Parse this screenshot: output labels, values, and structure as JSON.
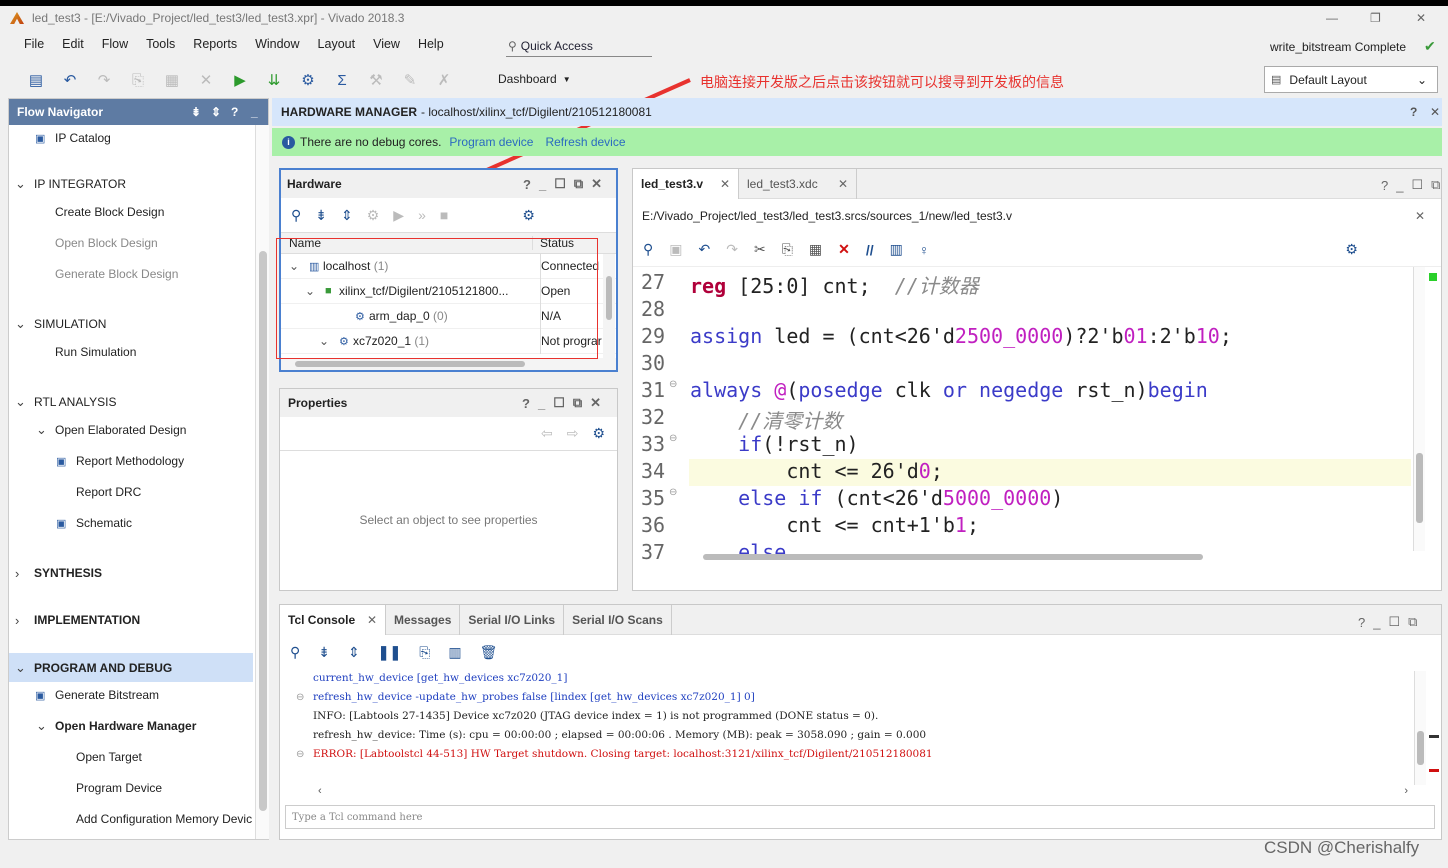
{
  "window": {
    "title": "led_test3 - [E:/Vivado_Project/led_test3/led_test3.xpr] - Vivado 2018.3",
    "min": "—",
    "max": "❐",
    "close": "✕"
  },
  "menu": [
    "File",
    "Edit",
    "Flow",
    "Tools",
    "Reports",
    "Window",
    "Layout",
    "View",
    "Help"
  ],
  "quick_access": "Quick Access",
  "status_right": "write_bitstream Complete",
  "dashboard": "Dashboard",
  "layout_select": "Default Layout",
  "annotation": "电脑连接开发版之后点击该按钮就可以搜寻到开发板的信息",
  "flow_nav": {
    "title": "Flow Navigator",
    "items": [
      {
        "label": "IP Catalog",
        "kind": "sub-icon"
      },
      {
        "label": "IP INTEGRATOR",
        "kind": "section"
      },
      {
        "label": "Create Block Design",
        "kind": "sub"
      },
      {
        "label": "Open Block Design",
        "kind": "sub-disabled"
      },
      {
        "label": "Generate Block Design",
        "kind": "sub-disabled"
      },
      {
        "label": "SIMULATION",
        "kind": "section"
      },
      {
        "label": "Run Simulation",
        "kind": "sub"
      },
      {
        "label": "RTL ANALYSIS",
        "kind": "section"
      },
      {
        "label": "Open Elaborated Design",
        "kind": "sub-open"
      },
      {
        "label": "Report Methodology",
        "kind": "sub2-icon"
      },
      {
        "label": "Report DRC",
        "kind": "sub2"
      },
      {
        "label": "Schematic",
        "kind": "sub2-icon"
      },
      {
        "label": "SYNTHESIS",
        "kind": "section-collapsed"
      },
      {
        "label": "IMPLEMENTATION",
        "kind": "section-collapsed"
      },
      {
        "label": "PROGRAM AND DEBUG",
        "kind": "section-active"
      },
      {
        "label": "Generate Bitstream",
        "kind": "sub-icon"
      },
      {
        "label": "Open Hardware Manager",
        "kind": "sub-open-bold"
      },
      {
        "label": "Open Target",
        "kind": "sub2"
      },
      {
        "label": "Program Device",
        "kind": "sub2"
      },
      {
        "label": "Add Configuration Memory Devic",
        "kind": "sub2"
      }
    ]
  },
  "hw_manager": {
    "title": "HARDWARE MANAGER",
    "path": "- localhost/xilinx_tcf/Digilent/210512180081",
    "banner": "There are no debug cores.",
    "link1": "Program device",
    "link2": "Refresh device"
  },
  "hardware": {
    "title": "Hardware",
    "col_name": "Name",
    "col_status": "Status",
    "rows": [
      {
        "name": "localhost",
        "count": "(1)",
        "status": "Connected"
      },
      {
        "name": "xilinx_tcf/Digilent/2105121800...",
        "count": "",
        "status": "Open"
      },
      {
        "name": "arm_dap_0",
        "count": "(0)",
        "status": "N/A"
      },
      {
        "name": "xc7z020_1",
        "count": "(1)",
        "status": "Not prograr"
      }
    ]
  },
  "properties": {
    "title": "Properties",
    "empty": "Select an object to see properties"
  },
  "editor": {
    "tabs": [
      "led_test3.v",
      "led_test3.xdc"
    ],
    "path": "E:/Vivado_Project/led_test3/led_test3.srcs/sources_1/new/led_test3.v",
    "line_numbers": [
      "27",
      "28",
      "29",
      "30",
      "31",
      "32",
      "33",
      "34",
      "35",
      "36",
      "37"
    ]
  },
  "console": {
    "tabs": [
      "Tcl Console",
      "Messages",
      "Serial I/O Links",
      "Serial I/O Scans"
    ],
    "lines": [
      "current_hw_device [get_hw_devices xc7z020_1]",
      "refresh_hw_device -update_hw_probes false [lindex [get_hw_devices xc7z020_1] 0]",
      "INFO: [Labtools 27-1435] Device xc7z020 (JTAG device index = 1) is not programmed (DONE status = 0).",
      "refresh_hw_device: Time (s): cpu = 00:00:00 ; elapsed = 00:00:06 . Memory (MB): peak = 3058.090 ; gain = 0.000",
      "ERROR: [Labtoolstcl 44-513] HW Target shutdown. Closing target: localhost:3121/xilinx_tcf/Digilent/210512180081"
    ],
    "placeholder": "Type a Tcl command here"
  },
  "watermark": "CSDN @Cherishalfy",
  "colors": {
    "accent": "#4a80d0",
    "banner": "#a8f0a8",
    "active": "#cfe0f7",
    "annotation": "#e8322e"
  }
}
